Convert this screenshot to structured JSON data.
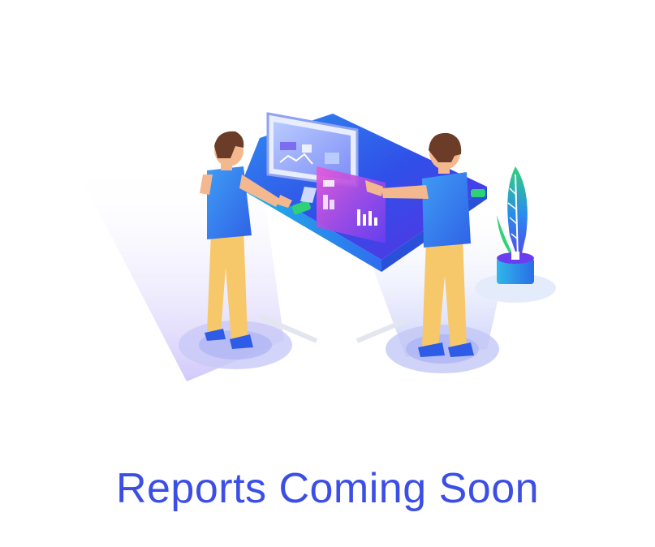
{
  "caption": "Reports Coming Soon",
  "colors": {
    "caption": "#3b4ee6",
    "primary_blue": "#2f6df0",
    "violet": "#6a3ef0",
    "cyan": "#28c3e8",
    "green": "#2fd07a",
    "magenta": "#c447e8",
    "skin": "#f4b88f",
    "hair": "#6b3d28",
    "pants": "#f6c86a",
    "floor_shadow": "#e7ecfb"
  },
  "icons": [
    "analytics-illustration",
    "monitor-icon",
    "chart-panel-icon",
    "plant-icon"
  ]
}
